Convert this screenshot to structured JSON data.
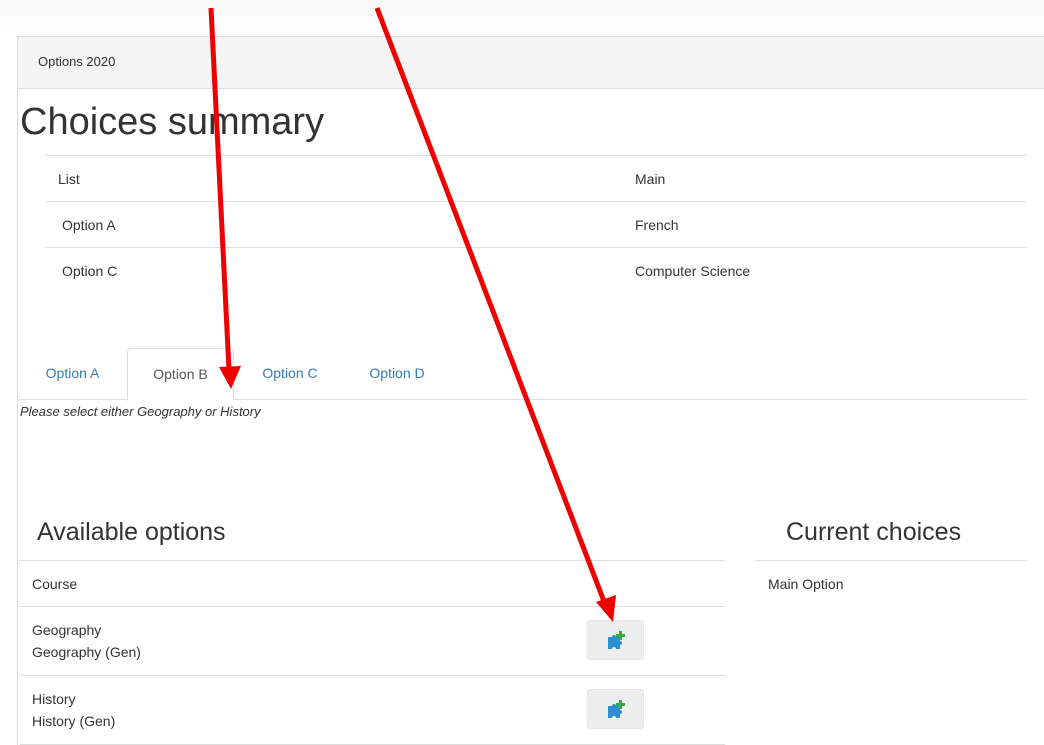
{
  "panel": {
    "heading": "Options 2020"
  },
  "summary": {
    "title": "Choices summary",
    "headers": [
      "List",
      "Main"
    ],
    "rows": [
      [
        "Option A",
        "French"
      ],
      [
        "Option C",
        "Computer Science"
      ]
    ]
  },
  "tabs": [
    {
      "label": "Option A",
      "active": false
    },
    {
      "label": "Option B",
      "active": true
    },
    {
      "label": "Option C",
      "active": false
    },
    {
      "label": "Option D",
      "active": false
    }
  ],
  "hint": "Please select either Geography or History",
  "available": {
    "title": "Available options",
    "header": "Course",
    "rows": [
      {
        "name": "Geography",
        "sub": "Geography (Gen)",
        "action_icon": "puzzle-add-icon"
      },
      {
        "name": "History",
        "sub": "History (Gen)",
        "action_icon": "puzzle-add-icon"
      }
    ]
  },
  "current": {
    "title": "Current choices",
    "header": "Main Option"
  },
  "colors": {
    "link": "#337ab7",
    "annotation_arrow": "#ee0000",
    "puzzle_blue": "#2f8fd0",
    "puzzle_green": "#2fae3a"
  }
}
